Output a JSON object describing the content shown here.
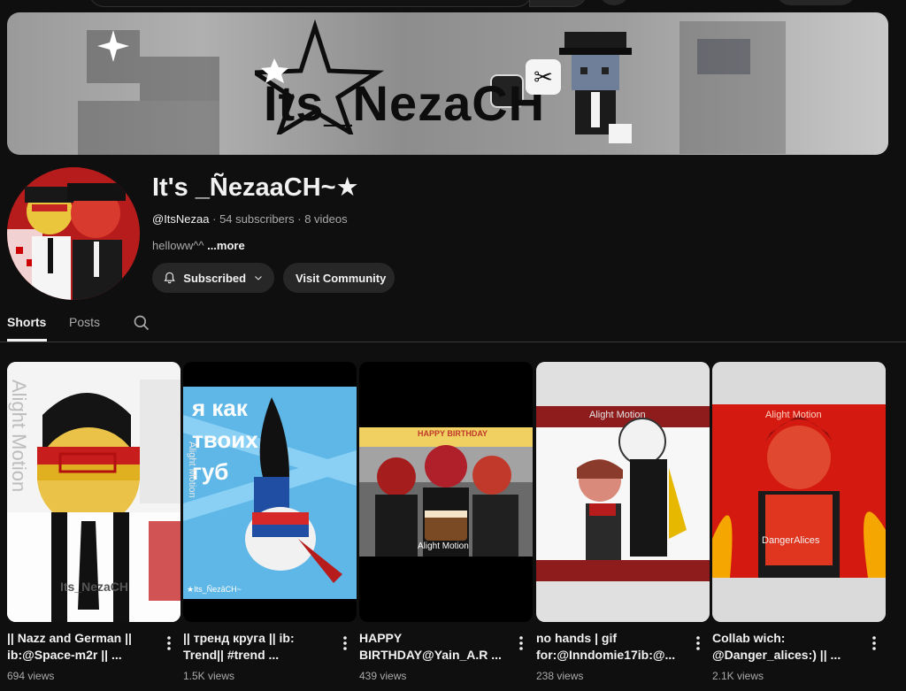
{
  "banner": {
    "title": "Its_NezaCH"
  },
  "channel": {
    "name": "It's _ÑezaaCH~★",
    "handle": "@ItsNezaa",
    "subscribers": "54 subscribers",
    "videos": "8 videos",
    "description": "helloww^^",
    "more_label": "...more"
  },
  "buttons": {
    "subscribed": "Subscribed",
    "community": "Visit Community"
  },
  "tabs": [
    {
      "label": "Shorts",
      "active": true
    },
    {
      "label": "Posts",
      "active": false
    }
  ],
  "shorts": [
    {
      "title": "|| Nazz and German || ib:@Space-m2r || ...",
      "views": "694 views",
      "watermark": "Alight Motion",
      "overlay": "Its_NezaCH"
    },
    {
      "title": "|| тренд круга || ib: Trend|| #trend ...",
      "views": "1.5K views",
      "watermark": "Alight Motion",
      "caption": "я как твоих губ",
      "overlay": "★Its_ÑezāCH~"
    },
    {
      "title": "HAPPY BIRTHDAY@Yain_A.R ...",
      "views": "439 views",
      "watermark": "Alight Motion",
      "overlay": "HAPPY BIRTHDAY"
    },
    {
      "title": "no hands | gif for:@Inndomie17ib:@...",
      "views": "238 views",
      "watermark": "Alight Motion"
    },
    {
      "title": "Collab wich: @Danger_alices:) || ...",
      "views": "2.1K views",
      "watermark": "Alight Motion",
      "overlay": "DangerAlices"
    }
  ],
  "colors": {
    "background": "#0f0f0f",
    "chip": "#272727",
    "text": "#f1f1f1",
    "muted": "#aaaaaa"
  }
}
